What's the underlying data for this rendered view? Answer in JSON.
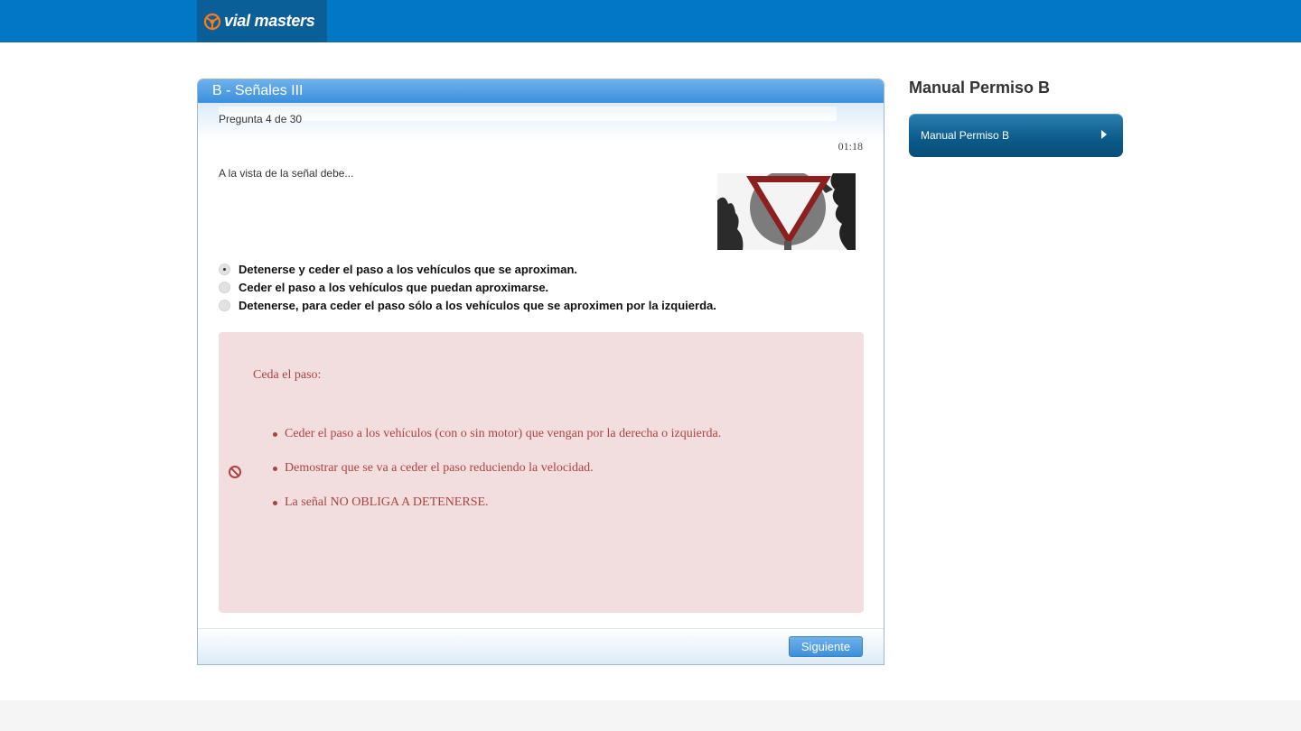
{
  "header": {
    "logo_text": "vial masters",
    "logo_icon": "steering-wheel-icon"
  },
  "quiz": {
    "title": "B - Señales III",
    "counter": "Pregunta 4 de 30",
    "timer": "01:18",
    "question": "A la vista de la señal debe...",
    "sign_image": "yield-sign-image",
    "answers": [
      {
        "label": "Detenerse y ceder el paso a los vehículos que se aproximan.",
        "selected": true
      },
      {
        "label": "Ceder el paso a los vehículos que puedan aproximarse.",
        "selected": false
      },
      {
        "label": "Detenerse, para ceder el paso sólo a los vehículos que se aproximen por la izquierda.",
        "selected": false
      }
    ],
    "explanation": {
      "icon": "prohibited-icon",
      "title": "Ceda el paso:",
      "items": [
        "Ceder el paso a los vehículos (con o sin motor) que vengan por la derecha o izquierda.",
        "Demostrar que se va a ceder el paso reduciendo la velocidad.",
        "La señal NO OBLIGA A DETENERSE."
      ],
      "color": "#a94442",
      "background": "#f2dede"
    },
    "next_label": "Siguiente"
  },
  "sidebar": {
    "title": "Manual Permiso B",
    "button_label": "Manual Permiso B"
  },
  "colors": {
    "header": "#0277c3",
    "accent": "#3e8fd9"
  }
}
